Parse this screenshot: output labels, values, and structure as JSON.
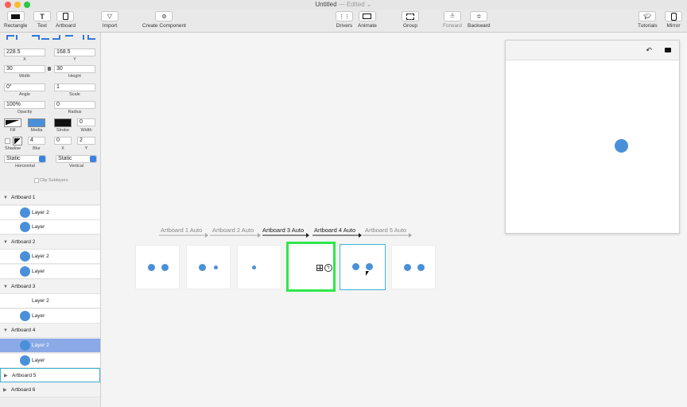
{
  "window": {
    "title": "Untitled",
    "edited": "— Edited ⌄"
  },
  "toolbar": {
    "rectangle": "Rectangle",
    "text": "Text",
    "artboard": "Artboard",
    "import": "Import",
    "create_component": "Create Component",
    "drivers": "Drivers",
    "animate": "Animate",
    "group": "Group",
    "forward": "Forward",
    "backward": "Backward",
    "tutorials": "Tutorials",
    "mirror": "Mirror"
  },
  "inspector": {
    "x": "228.5",
    "y": "168.5",
    "x_label": "X",
    "y_label": "Y",
    "width": "30",
    "height": "30",
    "width_label": "Width",
    "height_label": "Height",
    "angle": "0°",
    "scale": "1",
    "angle_label": "Angle",
    "scale_label": "Scale",
    "opacity": "100%",
    "radius": "0",
    "opacity_label": "Opacity",
    "radius_label": "Radius",
    "fill_label": "Fill",
    "media_label": "Media",
    "stroke_label": "Stroke",
    "stroke_width": "0",
    "stroke_width_label": "Width",
    "blur": "4",
    "shadow_x": "0",
    "shadow_y": "2",
    "shadow_label": "Shadow",
    "blur_label": "Blur",
    "sx_label": "X",
    "sy_label": "Y",
    "horizontal": "Static",
    "vertical": "Static",
    "horizontal_label": "Horizontal",
    "vertical_label": "Vertical",
    "clip_sublayers": "Clip Sublayers"
  },
  "layers": [
    {
      "name": "Artboard 1",
      "type": "group"
    },
    {
      "name": "Layer 2",
      "type": "item",
      "dot": true
    },
    {
      "name": "Layer",
      "type": "item",
      "dot": true
    },
    {
      "name": "Artboard 2",
      "type": "group"
    },
    {
      "name": "Layer 2",
      "type": "item",
      "dot": true
    },
    {
      "name": "Layer",
      "type": "item",
      "dot": true
    },
    {
      "name": "Artboard 3",
      "type": "group"
    },
    {
      "name": "Layer 2",
      "type": "item",
      "dot": false
    },
    {
      "name": "Layer",
      "type": "item",
      "dot": true
    },
    {
      "name": "Artboard 4",
      "type": "group"
    },
    {
      "name": "Layer 2",
      "type": "item",
      "dot": true,
      "state": "selected"
    },
    {
      "name": "Layer",
      "type": "item",
      "dot": true
    },
    {
      "name": "Artboard 5",
      "type": "group",
      "collapsed": true,
      "state": "outlined"
    },
    {
      "name": "Artboard 6",
      "type": "group",
      "collapsed": true
    }
  ],
  "transitions": [
    "Artboard 1 Auto",
    "Artboard 2 Auto",
    "Artboard 3 Auto",
    "Artboard 4 Auto",
    "Artboard 5 Auto"
  ],
  "colors": {
    "accent": "#4a90d9",
    "selected_artboard": "#2ee84a",
    "hover_artboard": "#3bb4d4",
    "selected_layer": "#8aa9e6"
  }
}
